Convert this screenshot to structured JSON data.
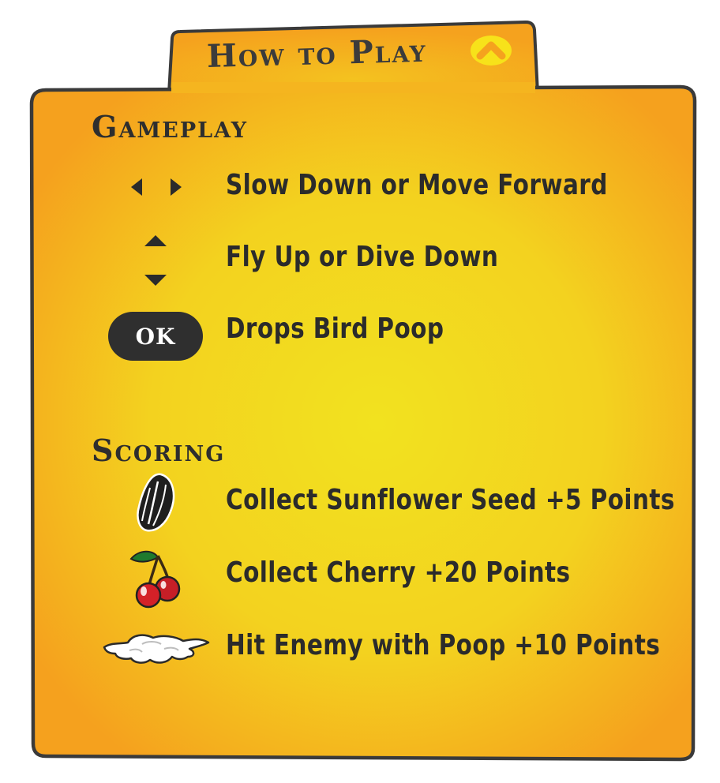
{
  "panel": {
    "title": "How to Play"
  },
  "gameplay": {
    "heading": "Gameplay",
    "rows": [
      {
        "icon": "left-right-arrows-icon",
        "text": "Slow Down or Move Forward"
      },
      {
        "icon": "up-down-arrows-icon",
        "text": "Fly Up or Dive Down"
      },
      {
        "icon": "ok-button-icon",
        "key_label": "OK",
        "text": "Drops Bird Poop"
      }
    ]
  },
  "scoring": {
    "heading": "Scoring",
    "rows": [
      {
        "icon": "sunflower-seed-icon",
        "text": "Collect Sunflower Seed +5 Points"
      },
      {
        "icon": "cherry-icon",
        "text": "Collect Cherry +20 Points"
      },
      {
        "icon": "bird-poop-splat-icon",
        "text": "Hit Enemy with Poop +10 Points"
      }
    ]
  },
  "colors": {
    "panel_center": "#f2dd20",
    "panel_edge": "#f5a21e",
    "outline": "#3a3a3a",
    "text": "#2b2b2b",
    "collapse_icon": "#f7e21a"
  }
}
